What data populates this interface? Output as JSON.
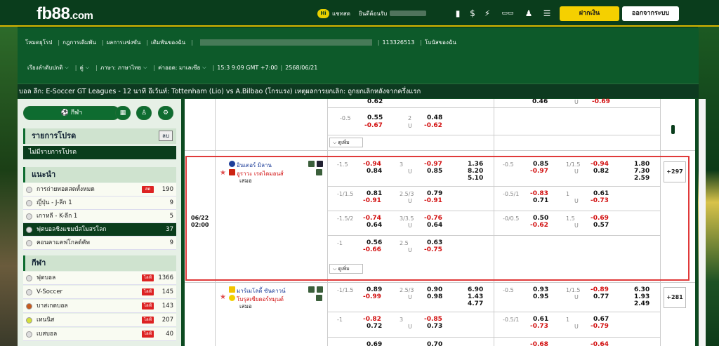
{
  "header": {
    "logo_text": "fb88",
    "logo_dot_com": ".com",
    "chat": "แชทสด",
    "welcome": "ยินดีต้อนรับ",
    "deposit": "ฝากเงิน",
    "withdraw": "ออกจากระบบ",
    "badge": "Hi"
  },
  "subnav": {
    "links": [
      "โหมดยุโรป",
      "กฎการเดิมพัน",
      "ผลการแข่งขัน",
      "เดิมพันของฉัน"
    ],
    "account": "113326513",
    "bonus": "โบนัสของฉัน"
  },
  "settings": {
    "sort": "เรียงลำดับปกติ",
    "odds_type": "คู่",
    "language": "ภาษา: ภาษาไทย",
    "odds_format": "ค่าออด: มาเลเซีย",
    "time": "15:3 9:09 GMT +7:00",
    "date": "2568/06/21"
  },
  "ticker": "บอล ลีก: E-Soccer GT Leagues - 12 นาที อีเว้นท์: Tottenham (Lio) vs A.Bilbao (โกรแรง) เหตุผลการยกเลิก: ถูกยกเลิกหลังจากครึ่งแรก",
  "sidebar": {
    "sport_tab": "กีฬา",
    "fav_title": "รายการโปรด",
    "fav_delete": "ลบ",
    "fav_empty": "ไม่มีรายการโปรด",
    "rec_title": "แนะนำ",
    "recommended": [
      {
        "label": "การถ่ายทอดสดทั้งหมด",
        "count": "190",
        "tag": "สด"
      },
      {
        "label": "ญี่ปุ่น - J-ลีก 1",
        "count": "9"
      },
      {
        "label": "เกาหลี - K-ลีก 1",
        "count": "5"
      },
      {
        "label": "ฟุตบอลชิงแชมป์สโมสรโลก",
        "count": "37"
      },
      {
        "label": "คอนคาแคฟโกลด์คัพ",
        "count": "9"
      }
    ],
    "sports_title": "กีฬา",
    "sports": [
      {
        "label": "ฟุตบอล",
        "count": "1366",
        "tag": "ไลฟ์"
      },
      {
        "label": "V-Soccer",
        "count": "145",
        "tag": "ไลฟ์"
      },
      {
        "label": "บาสเกตบอล",
        "count": "143",
        "tag": "ไลฟ์"
      },
      {
        "label": "เทนนิส",
        "count": "207",
        "tag": "ไลฟ์"
      },
      {
        "label": "เบสบอล",
        "count": "40",
        "tag": "ไลฟ์"
      }
    ]
  },
  "top_partial": {
    "r1": [
      "0.62",
      "-0.5",
      "0.55",
      "-0.67",
      "2",
      "U",
      "0.48",
      "-0.62"
    ],
    "right": [
      "0.46",
      "U",
      "-0.69"
    ]
  },
  "more_label": "ดูเพิ่ม",
  "match1": {
    "date": "06/22",
    "time": "02:00",
    "home": "อินเตอร์ มิลาน",
    "away": "อูราวะ เรดไดมอนส์",
    "draw": "เสมอ",
    "plus": "+297",
    "rows": [
      {
        "h": "-1.5",
        "h1": "-0.94",
        "h2": "0.84",
        "ou": "3",
        "ou1": "-0.97",
        "ou2": "0.85",
        "u": "U",
        "x": [
          "1.36",
          "8.20",
          "5.10"
        ],
        "hh": "-0.5",
        "hh1": "0.85",
        "hh2": "-0.97",
        "ho": "1/1.5",
        "ho1": "-0.94",
        "ho2": "0.82",
        "hu": "U",
        "hx": [
          "1.80",
          "7.30",
          "2.59"
        ]
      },
      {
        "h": "-1/1.5",
        "h1": "0.81",
        "h2": "-0.91",
        "ou": "2.5/3",
        "ou1": "0.79",
        "ou2": "-0.91",
        "u": "U",
        "hh": "-0.5/1",
        "hh1": "-0.83",
        "hh2": "0.71",
        "ho": "1",
        "ho1": "0.61",
        "ho2": "-0.73",
        "hu": "U"
      },
      {
        "h": "-1.5/2",
        "h1": "-0.74",
        "h2": "0.64",
        "ou": "3/3.5",
        "ou1": "-0.76",
        "ou2": "0.64",
        "u": "U",
        "hh": "-0/0.5",
        "hh1": "0.50",
        "hh2": "-0.62",
        "ho": "1.5",
        "ho1": "-0.69",
        "ho2": "0.57",
        "hu": "U"
      },
      {
        "h": "-1",
        "h1": "0.56",
        "h2": "-0.66",
        "ou": "2.5",
        "ou1": "0.63",
        "ou2": "-0.75",
        "u": "U"
      }
    ]
  },
  "match2": {
    "home": "มาร์เมโลดี้ ซันดาวน์",
    "away": "โบรุสเซียดอร์ทมุนด์",
    "draw": "เสมอ",
    "plus": "+281",
    "rows": [
      {
        "h": "-1/1.5",
        "h1": "0.89",
        "h2": "-0.99",
        "ou": "2.5/3",
        "ou1": "0.90",
        "ou2": "0.98",
        "u": "U",
        "x": [
          "6.90",
          "1.43",
          "4.77"
        ],
        "hh": "-0.5",
        "hh1": "0.93",
        "hh2": "0.95",
        "ho": "1/1.5",
        "ho1": "-0.89",
        "ho2": "0.77",
        "hu": "U",
        "hx": [
          "6.30",
          "1.93",
          "2.49"
        ]
      },
      {
        "h": "-1",
        "h1": "-0.82",
        "h2": "0.72",
        "ou": "3",
        "ou1": "-0.85",
        "ou2": "0.73",
        "u": "U",
        "hh": "-0.5/1",
        "hh1": "0.61",
        "hh2": "-0.73",
        "ho": "1",
        "ho1": "0.67",
        "ho2": "-0.79",
        "hu": "U"
      },
      {
        "h": "",
        "h1": "0.69",
        "ou1": "0.70",
        "hh1": "-0.68",
        "ho1": "-0.64"
      }
    ]
  },
  "colors": {
    "brand": "#0a3d1c",
    "accent": "#f5d000",
    "neg": "#d21010",
    "highlight": "#e03a3a"
  }
}
